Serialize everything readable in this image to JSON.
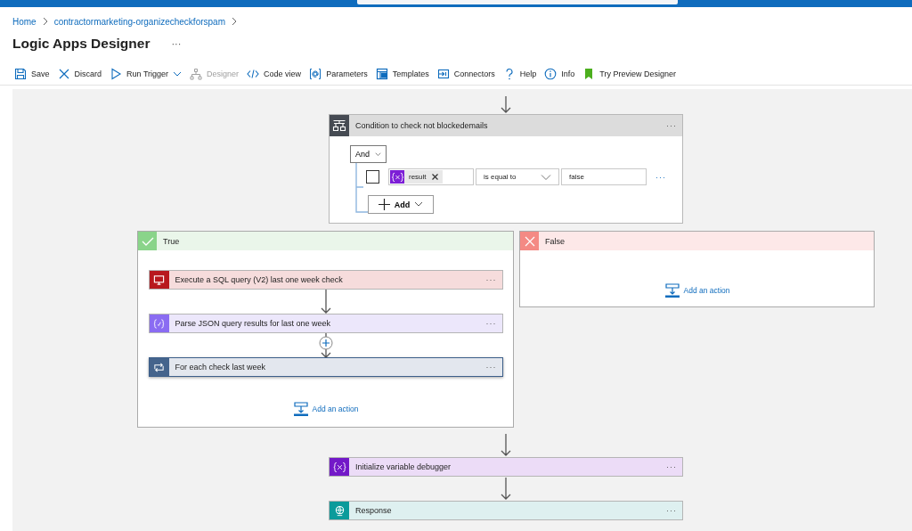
{
  "breadcrumb": [
    {
      "label": "Home"
    },
    {
      "label": "contractormarketing-organizecheckforspam"
    }
  ],
  "page_title": "Logic Apps Designer",
  "page_more": "···",
  "toolbar": [
    {
      "kind": "save",
      "label": "Save",
      "disabled": false,
      "has_menu": false
    },
    {
      "kind": "discard",
      "label": "Discard",
      "disabled": false,
      "has_menu": false
    },
    {
      "kind": "run",
      "label": "Run Trigger",
      "disabled": false,
      "has_menu": true
    },
    {
      "kind": "designer",
      "label": "Designer",
      "disabled": true,
      "has_menu": false
    },
    {
      "kind": "code",
      "label": "Code view",
      "disabled": false,
      "has_menu": false
    },
    {
      "kind": "parameters",
      "label": "Parameters",
      "disabled": false,
      "has_menu": false
    },
    {
      "kind": "templates",
      "label": "Templates",
      "disabled": false,
      "has_menu": false
    },
    {
      "kind": "connectors",
      "label": "Connectors",
      "disabled": false,
      "has_menu": false
    },
    {
      "kind": "help",
      "label": "Help",
      "disabled": false,
      "has_menu": false
    },
    {
      "kind": "info",
      "label": "Info",
      "disabled": false,
      "has_menu": false
    },
    {
      "kind": "preview",
      "label": "Try Preview Designer",
      "disabled": false,
      "has_menu": false
    }
  ],
  "condition": {
    "title": "Condition to check not blockedemails",
    "more": "···",
    "group_operator": "And",
    "rule": {
      "checked": false,
      "operand": "result",
      "operator": "is equal to",
      "value": "false",
      "more": "···"
    },
    "add_label": "Add"
  },
  "branches": [
    {
      "kind": "true",
      "title": "True",
      "add_label": "Add an action",
      "actions": [
        {
          "kind": "sql",
          "title": "Execute a SQL query (V2) last one week check",
          "more": "···",
          "selected": false
        },
        {
          "kind": "json",
          "title": "Parse JSON query results for last one week",
          "more": "···",
          "selected": false
        },
        {
          "kind": "foreach",
          "title": "For each check last week",
          "more": "···",
          "selected": true
        }
      ]
    },
    {
      "kind": "false",
      "title": "False",
      "add_label": "Add an action"
    }
  ],
  "after": [
    {
      "kind": "variable",
      "title": "Initialize variable debugger",
      "more": "···",
      "selected": false
    },
    {
      "kind": "response",
      "title": "Response",
      "more": "···",
      "selected": false
    }
  ]
}
